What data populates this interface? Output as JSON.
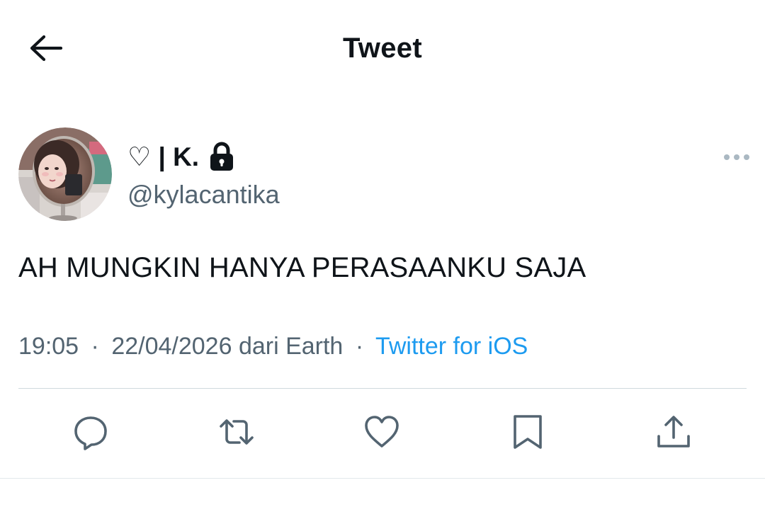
{
  "header": {
    "title": "Tweet",
    "back_icon": "arrow-left-icon"
  },
  "author": {
    "display_name": "♡ | K.",
    "protected_icon": "lock-icon",
    "handle": "@kylacantika",
    "avatar_description_icon": "avatar"
  },
  "tweet": {
    "text": "AH MUNGKIN HANYA PERASAANKU SAJA",
    "time": "19:05",
    "date_location": "22/04/2026 dari Earth",
    "separator": "·",
    "source": "Twitter for iOS"
  },
  "actions": {
    "reply_icon": "reply-icon",
    "retweet_icon": "retweet-icon",
    "like_icon": "heart-icon",
    "bookmark_icon": "bookmark-icon",
    "share_icon": "share-icon"
  },
  "colors": {
    "text": "#0f1419",
    "secondary": "#536471",
    "link": "#1d9bf0",
    "divider": "#cfd9de"
  }
}
